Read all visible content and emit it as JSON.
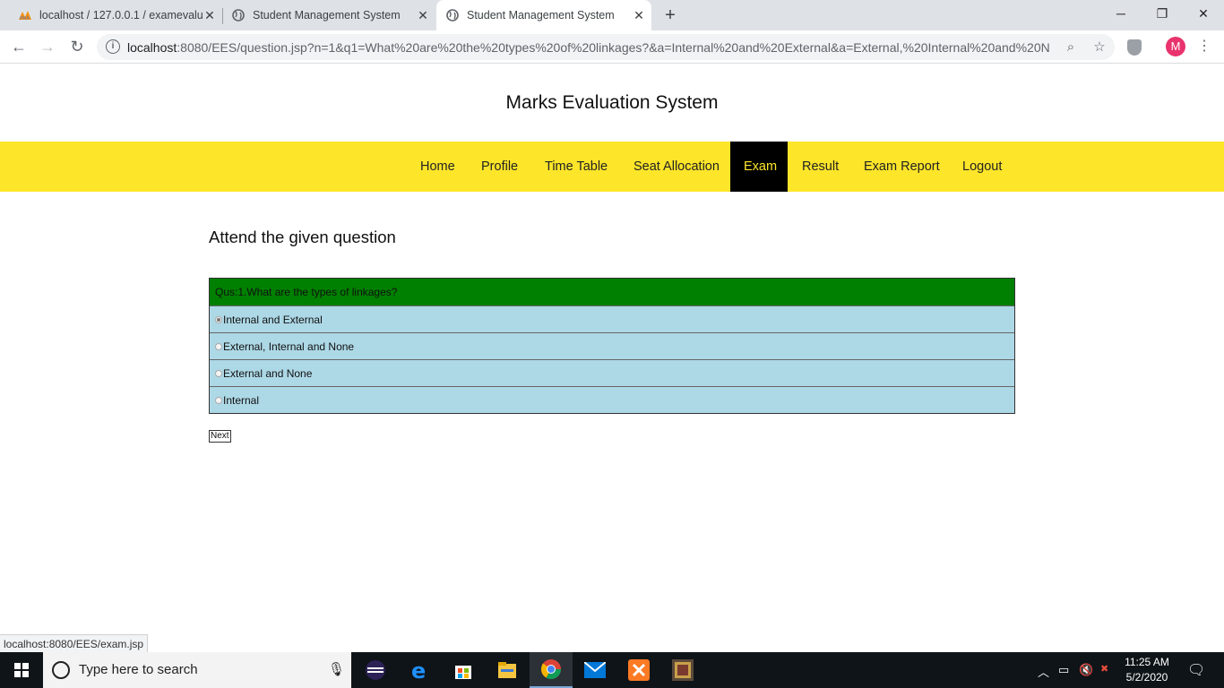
{
  "browser": {
    "tabs": [
      {
        "title": "localhost / 127.0.0.1 / examevalu",
        "icon": "phpmyadmin-icon"
      },
      {
        "title": "Student Management System",
        "icon": "globe-icon"
      },
      {
        "title": "Student Management System",
        "icon": "globe-icon",
        "active": true
      }
    ],
    "url_host": "localhost",
    "url_rest": ":8080/EES/question.jsp?n=1&q1=What%20are%20the%20types%20of%20linkages?&a=Internal%20and%20External&a=External,%20Internal%20and%20No...",
    "avatar_letter": "M",
    "status_url": "localhost:8080/EES/exam.jsp"
  },
  "site": {
    "title": "Marks Evaluation System",
    "nav": [
      "Home",
      "Profile",
      "Time Table",
      "Seat Allocation",
      "Exam",
      "Result",
      "Exam Report",
      "Logout"
    ],
    "active_nav": "Exam",
    "accent_color": "#fde52a"
  },
  "exam": {
    "heading": "Attend the given question",
    "question": "Qus:1.What are the types of linkages?",
    "options": [
      "Internal and External",
      "External, Internal and None",
      "External and None",
      "Internal"
    ],
    "selected_option": "Internal and External",
    "next_label": "Next"
  },
  "taskbar": {
    "search_placeholder": "Type here to search",
    "time": "11:25 AM",
    "date": "5/2/2020"
  }
}
